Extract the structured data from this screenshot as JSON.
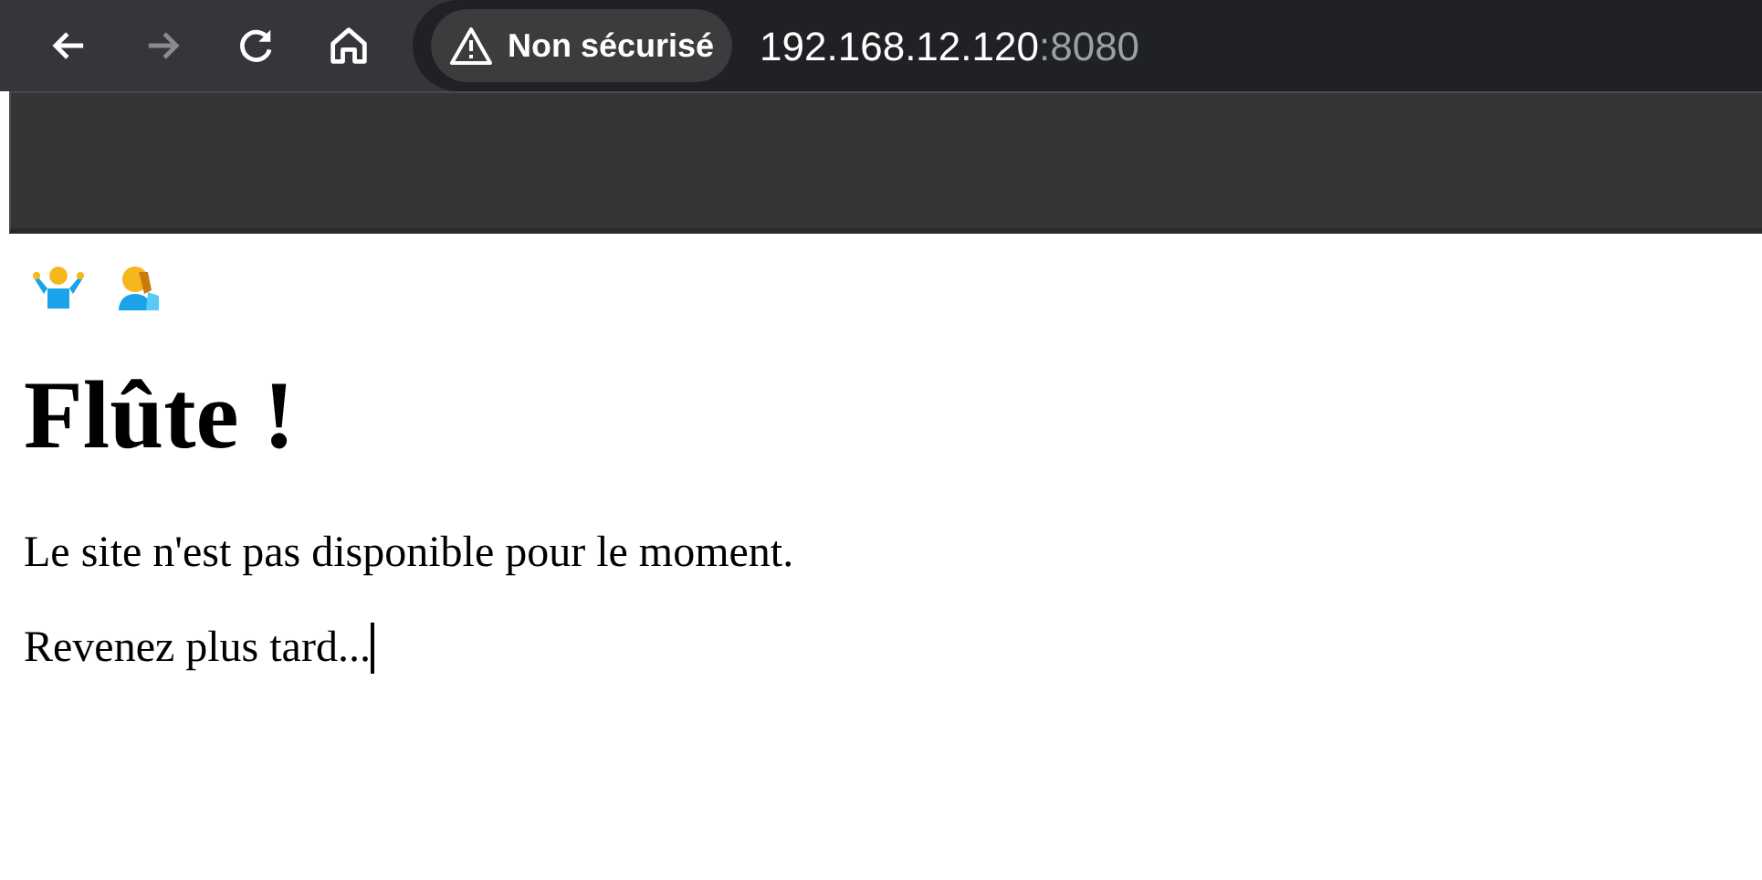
{
  "toolbar": {
    "buttons": [
      {
        "kind": "back",
        "disabled": false
      },
      {
        "kind": "forward",
        "disabled": true
      },
      {
        "kind": "reload",
        "disabled": false
      },
      {
        "kind": "home",
        "disabled": false
      }
    ]
  },
  "address_bar": {
    "security_chip": "Non sécurisé",
    "url_host": "192.168.12.120",
    "url_port": ":8080"
  },
  "page": {
    "heading": "Flûte !",
    "paragraphs": [
      "Le site n'est pas disponible pour le moment.",
      "Revenez plus tard..."
    ]
  }
}
